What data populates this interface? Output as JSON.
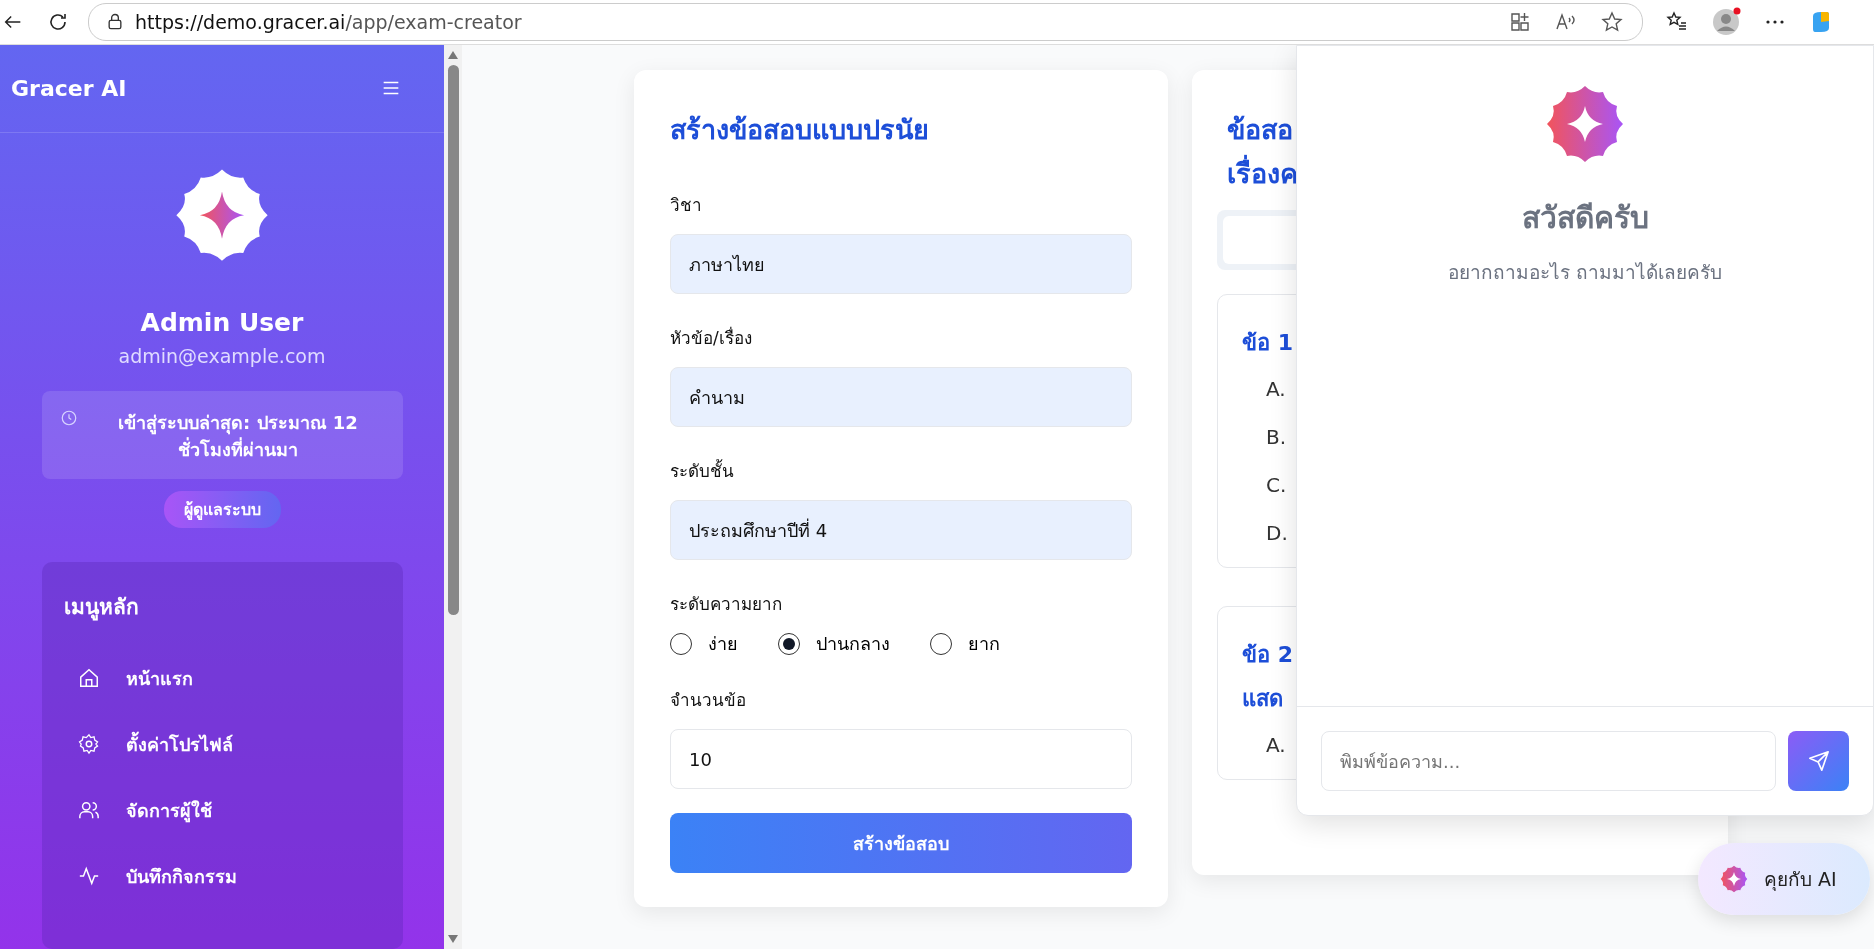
{
  "browser": {
    "url_host": "https://demo.gracer.ai",
    "url_path": "/app/exam-creator"
  },
  "sidebar": {
    "brand": "Gracer AI",
    "user_name": "Admin User",
    "user_email": "admin@example.com",
    "last_login": "เข้าสู่ระบบล่าสุด: ประมาณ 12 ชั่วโมงที่ผ่านมา",
    "role": "ผู้ดูแลระบบ",
    "menu_title": "เมนูหลัก",
    "menu": [
      {
        "label": "หน้าแรก",
        "kind": "home"
      },
      {
        "label": "ตั้งค่าโปรไฟล์",
        "kind": "settings"
      },
      {
        "label": "จัดการผู้ใช้",
        "kind": "users"
      },
      {
        "label": "บันทึกกิจกรรม",
        "kind": "activity"
      }
    ]
  },
  "form": {
    "title": "สร้างข้อสอบแบบปรนัย",
    "fields": [
      {
        "label": "วิชา",
        "value": "ภาษาไทย",
        "kind": "select"
      },
      {
        "label": "หัวข้อ/เรื่อง",
        "value": "คำนาม",
        "kind": "select"
      },
      {
        "label": "ระดับชั้น",
        "value": "ประถมศึกษาปีที่ 4",
        "kind": "select"
      }
    ],
    "difficulty": {
      "label": "ระดับความยาก",
      "options": [
        {
          "label": "ง่าย",
          "selected": false
        },
        {
          "label": "ปานกลาง",
          "selected": true
        },
        {
          "label": "ยาก",
          "selected": false
        }
      ]
    },
    "count": {
      "label": "จำนวนข้อ",
      "value": "10"
    },
    "submit": "สร้างข้อสอบ"
  },
  "results": {
    "title_lines": [
      "ข้อสอ",
      "เรื่องค"
    ],
    "questions": [
      {
        "title_lines": [
          "ข้อ 1"
        ],
        "options": [
          "A.",
          "B.",
          "C.",
          "D."
        ]
      },
      {
        "title_lines": [
          "ข้อ 2",
          "แสด"
        ],
        "options": [
          "A."
        ]
      }
    ]
  },
  "chat": {
    "greeting": "สวัสดีครับ",
    "subtitle": "อยากถามอะไร ถามมาได้เลยครับ",
    "placeholder": "พิมพ์ข้อความ...",
    "fab_label": "คุยกับ AI"
  }
}
